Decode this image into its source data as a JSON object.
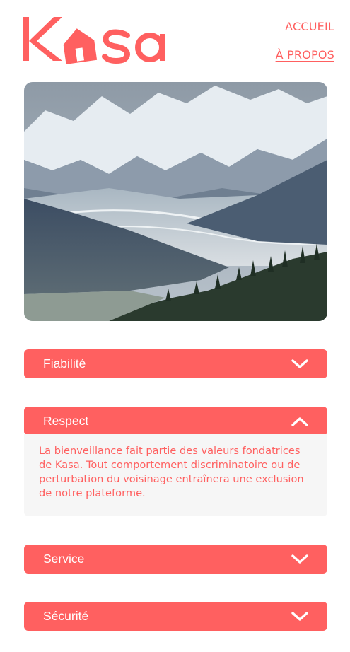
{
  "header": {
    "logo_text": "Kasa",
    "nav": {
      "home_label": "ACCUEIL",
      "about_label": "À PROPOS"
    }
  },
  "banner": {
    "description": "mountain-landscape"
  },
  "collapses": [
    {
      "title": "Fiabilité",
      "open": false,
      "icon": "chevron-down-icon"
    },
    {
      "title": "Respect",
      "open": true,
      "icon": "chevron-up-icon",
      "content": "La bienveillance fait partie des valeurs fondatrices de Kasa. Tout comportement discriminatoire ou de perturbation du voisinage entraînera une exclusion de notre plateforme."
    },
    {
      "title": "Service",
      "open": false,
      "icon": "chevron-down-icon"
    },
    {
      "title": "Sécurité",
      "open": false,
      "icon": "chevron-down-icon"
    }
  ],
  "colors": {
    "primary": "#FF6060",
    "panel_bg": "#F6F6F6",
    "text_on_primary": "#FFFFFF"
  }
}
